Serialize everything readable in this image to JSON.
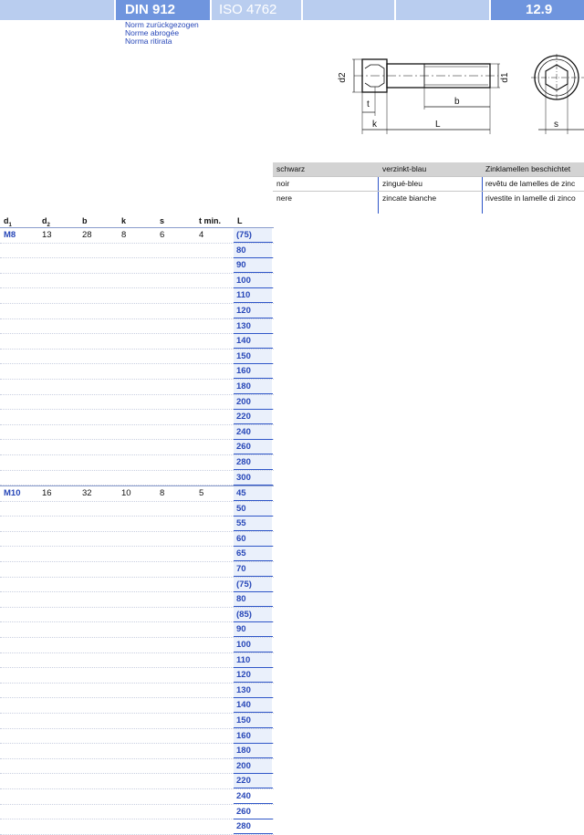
{
  "header": {
    "norm_din": "DIN 912",
    "norm_iso": "ISO 4762",
    "grade": "12.9",
    "notes": [
      "Norm zurückgezogen",
      "Norme abrogée",
      "Norma ritirata"
    ]
  },
  "drawing": {
    "labels": {
      "d2": "d2",
      "d1": "d1",
      "t": "t",
      "k": "k",
      "b": "b",
      "L": "L",
      "s": "s"
    }
  },
  "coatings": {
    "rows": [
      [
        "schwarz",
        "verzinkt-blau",
        "Zinklamellen beschichtet"
      ],
      [
        "noir",
        "zingué-bleu",
        "revêtu de lamelles de zinc"
      ],
      [
        "nere",
        "zincate bianche",
        "rivestite in lamelle di zinco"
      ]
    ]
  },
  "dims": {
    "headers": {
      "d1": "d",
      "d1_sub": "1",
      "d2": "d",
      "d2_sub": "2",
      "b": "b",
      "k": "k",
      "s": "s",
      "t": "t min.",
      "L": "L"
    },
    "groups": [
      {
        "d1": "M8",
        "d2": "13",
        "b": "28",
        "k": "8",
        "s": "6",
        "t": "4",
        "lengths": [
          "(75)",
          "80",
          "90",
          "100",
          "110",
          "120",
          "130",
          "140",
          "150",
          "160",
          "180",
          "200",
          "220",
          "240",
          "260",
          "280",
          "300"
        ]
      },
      {
        "d1": "M10",
        "d2": "16",
        "b": "32",
        "k": "10",
        "s": "8",
        "t": "5",
        "lengths": [
          "45",
          "50",
          "55",
          "60",
          "65",
          "70",
          "(75)",
          "80",
          "(85)",
          "90",
          "100",
          "110",
          "120",
          "130",
          "140",
          "150",
          "160",
          "180",
          "200",
          "220",
          "240",
          "260",
          "280"
        ]
      }
    ]
  }
}
